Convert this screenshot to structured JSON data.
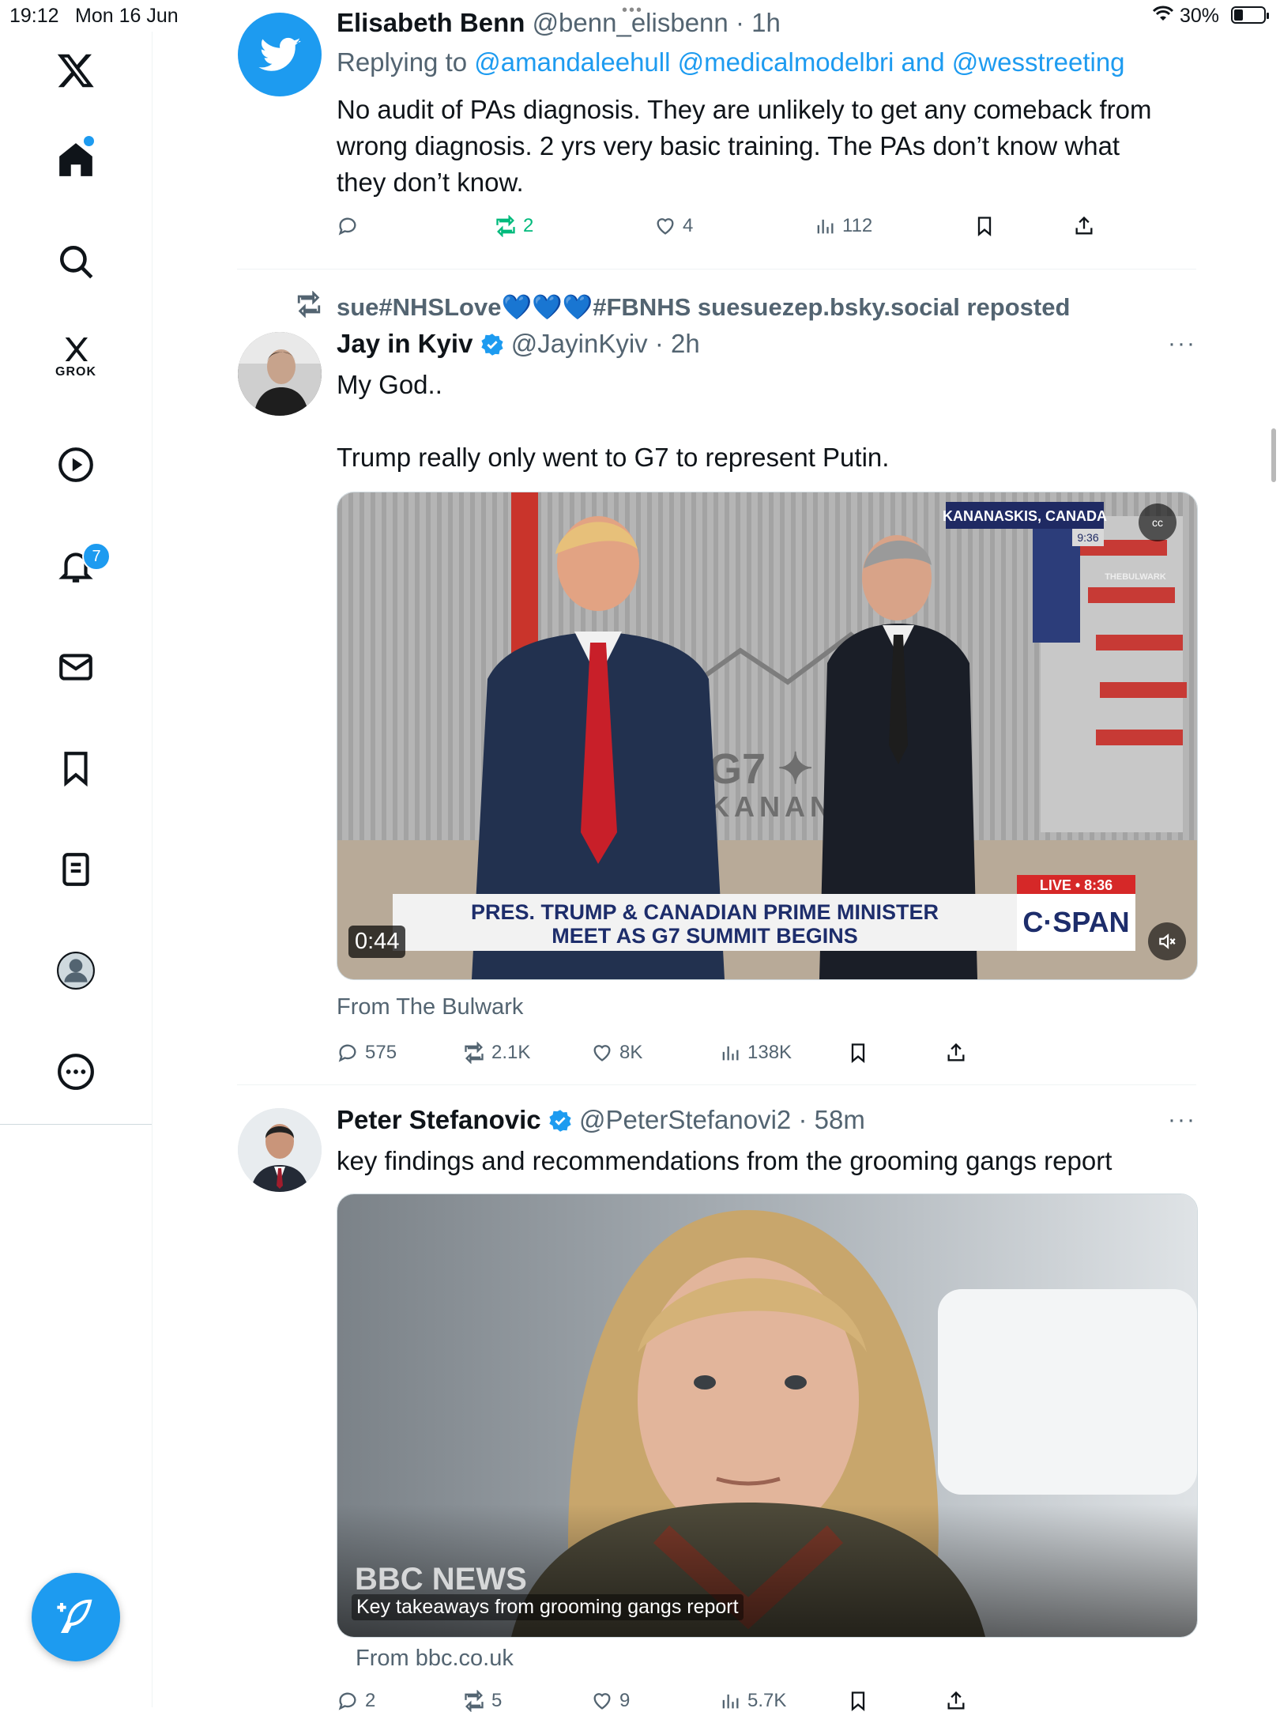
{
  "status_bar": {
    "time": "19:12",
    "date": "Mon 16 Jun",
    "battery": "30%"
  },
  "sidebar": {
    "grok_label": "GROK",
    "notifications_badge": "7"
  },
  "tweets": [
    {
      "name": "Elisabeth Benn",
      "handle": "@benn_elisbenn",
      "time": "· 1h",
      "replying_prefix": "Replying to",
      "replying_to": "@amandaleehull @medicalmodelbri and @wesstreeting",
      "text_lines": [
        "No audit of PAs diagnosis. They are unlikely to get any comeback  from",
        "wrong diagnosis. 2 yrs very basic training. The PAs don’t know what",
        "they don’t know."
      ],
      "reposts": "2",
      "likes": "4",
      "views": "112"
    },
    {
      "repost_by": "sue#NHSLove💙💙💙#FBNHS suesuezep.bsky.social reposted",
      "name": "Jay in Kyiv",
      "handle": "@JayinKyiv",
      "time": "· 2h",
      "text_line1": "My God..",
      "text_line2": "Trump really only went to G7 to represent Putin.",
      "video": {
        "duration": "0:44",
        "location": "KANANASKIS, CANADA",
        "time_small": "9:36",
        "caption_line1": "PRES. TRUMP & CANADIAN PRIME MINISTER",
        "caption_line2": "MEET AS G7 SUMMIT BEGINS",
        "live": "LIVE • 8:36",
        "network": "C·SPAN",
        "backdrop_line1": "G7 ✦ 202",
        "backdrop_line2": "KANANASKI",
        "watermark": "THEBULWARK",
        "cc": "cc"
      },
      "source": "From The Bulwark",
      "replies": "575",
      "reposts": "2.1K",
      "likes": "8K",
      "views": "138K"
    },
    {
      "name": "Peter Stefanovic",
      "handle": "@PeterStefanovi2",
      "time": "· 58m",
      "text": "key findings and recommendations from the grooming gangs report",
      "card_brand": "BBC NEWS",
      "card_title": "Key takeaways from grooming gangs report",
      "source": "From bbc.co.uk",
      "replies": "2",
      "reposts": "5",
      "likes": "9",
      "views": "5.7K"
    }
  ],
  "colors": {
    "accent": "#1d9bf0",
    "text": "#0f1419",
    "muted": "#536471",
    "repost_green": "#00ba7c",
    "cspan_red": "#d62828"
  }
}
